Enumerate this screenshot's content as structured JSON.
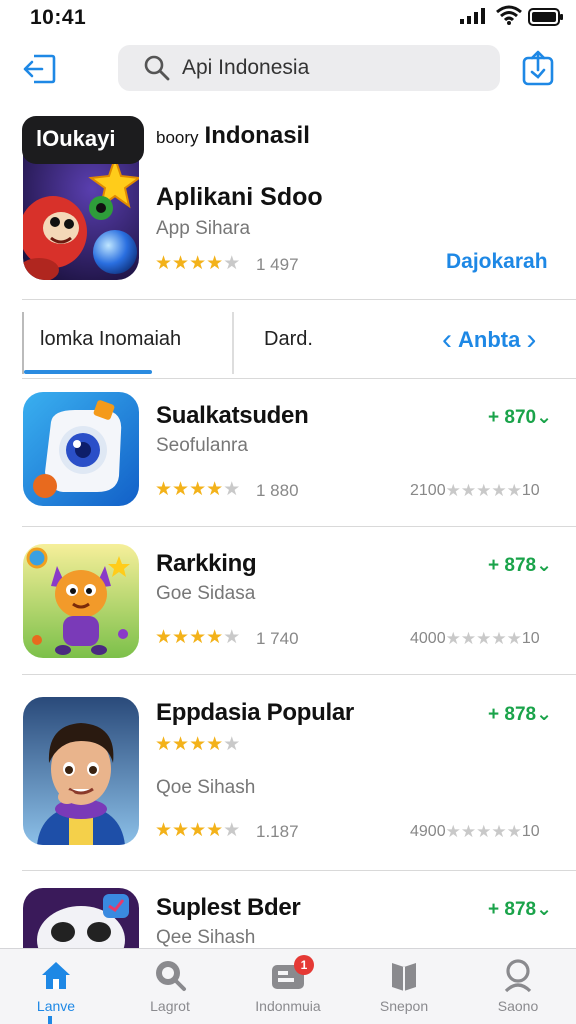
{
  "status_bar": {
    "time": "10:41"
  },
  "search": {
    "value": "Api Indonesia"
  },
  "featured": {
    "badge": "lOukayi",
    "header_small": "boory",
    "header": "Indonasil",
    "title": "Aplikani Sdoo",
    "subtitle": "App Sihara",
    "rating": 4,
    "rating_count": "1 497",
    "action": "Dajokarah"
  },
  "tabs": {
    "primary": "lomka Inomaiah",
    "secondary": "Dard.",
    "nav_label": "Anbta"
  },
  "apps": [
    {
      "title": "Sualkatsuden",
      "subtitle": "Seofulanra",
      "price": "+ 870",
      "rating": 3.5,
      "rating_count": "1 880",
      "extra": "2100",
      "extra_count": "10"
    },
    {
      "title": "Rarkking",
      "subtitle": "Goe Sidasa",
      "price": "+ 878",
      "rating": 3.5,
      "rating_count": "1 740",
      "extra": "4000",
      "extra_count": "10"
    },
    {
      "title": "Eppdasia Popular",
      "subtitle": "Qoe Sihash",
      "price": "+ 878",
      "rating": 3.5,
      "rating_count": "1.187",
      "extra": "4900",
      "extra_count": "10"
    },
    {
      "title": "Suplest Bder",
      "subtitle": "Qee Sihash",
      "price": "+ 878"
    }
  ],
  "tab_bar": {
    "items": [
      {
        "label": "Lanve",
        "active": true
      },
      {
        "label": "Lagrot"
      },
      {
        "label": "Indonmuia",
        "badge": "1"
      },
      {
        "label": "Snepon"
      },
      {
        "label": "Saono"
      }
    ]
  },
  "colors": {
    "accent": "#1e88e5",
    "price": "#1aa34a",
    "star": "#f3b21a",
    "badge": "#e53935"
  }
}
